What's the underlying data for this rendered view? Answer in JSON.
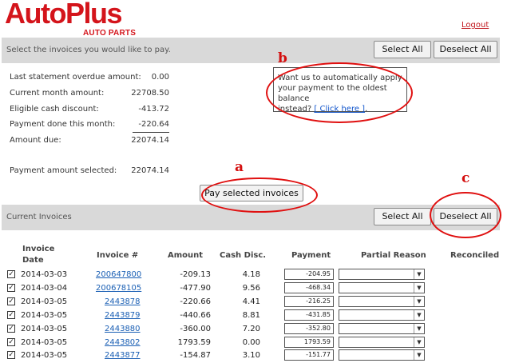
{
  "brand": {
    "name": "AutoPlus",
    "tagline": "AUTO PARTS"
  },
  "header": {
    "logout_label": "Logout"
  },
  "select_bar": {
    "instruction": "Select the invoices you would like to pay.",
    "select_all": "Select All",
    "deselect_all": "Deselect All"
  },
  "summary": [
    {
      "label": "Last statement overdue amount:",
      "value": "0.00"
    },
    {
      "label": "Current month amount:",
      "value": "22708.50"
    },
    {
      "label": "Eligible cash discount:",
      "value": "-413.72"
    },
    {
      "label": "Payment done this month:",
      "value": "-220.64"
    },
    {
      "label": "Amount due:",
      "value": "22074.14"
    }
  ],
  "payment_selected": {
    "label": "Payment amount selected:",
    "value": "22074.14"
  },
  "auto_apply": {
    "line1": "Want us to automatically apply",
    "line2": "your payment to the oldest balance",
    "line3_prefix": "instead? ",
    "link_label": "[ Click here ]",
    "line3_suffix": "."
  },
  "pay_button": "Pay selected invoices",
  "invoices_bar": {
    "title": "Current Invoices",
    "select_all": "Select All",
    "deselect_all": "Deselect All"
  },
  "annotations": {
    "a": "a",
    "b": "b",
    "c": "c"
  },
  "annotation_color": "#e01010",
  "brand_color": "#d4141b",
  "table": {
    "headers": {
      "invoice_date_1": "Invoice",
      "invoice_date_2": "Date",
      "invoice_num": "Invoice #",
      "amount": "Amount",
      "cash_disc": "Cash Disc.",
      "payment": "Payment",
      "partial_reason": "Partial Reason",
      "reconciled": "Reconciled"
    },
    "rows": [
      {
        "checked": "✓",
        "date": "2014-03-03",
        "invoice": "200647800",
        "amount": "-209.13",
        "cash_disc": "4.18",
        "payment": "-204.95"
      },
      {
        "checked": "✓",
        "date": "2014-03-04",
        "invoice": "200678105",
        "amount": "-477.90",
        "cash_disc": "9.56",
        "payment": "-468.34"
      },
      {
        "checked": "✓",
        "date": "2014-03-05",
        "invoice": "2443878",
        "amount": "-220.66",
        "cash_disc": "4.41",
        "payment": "-216.25"
      },
      {
        "checked": "✓",
        "date": "2014-03-05",
        "invoice": "2443879",
        "amount": "-440.66",
        "cash_disc": "8.81",
        "payment": "-431.85"
      },
      {
        "checked": "✓",
        "date": "2014-03-05",
        "invoice": "2443880",
        "amount": "-360.00",
        "cash_disc": "7.20",
        "payment": "-352.80"
      },
      {
        "checked": "✓",
        "date": "2014-03-05",
        "invoice": "2443802",
        "amount": "1793.59",
        "cash_disc": "0.00",
        "payment": "1793.59"
      },
      {
        "checked": "✓",
        "date": "2014-03-05",
        "invoice": "2443877",
        "amount": "-154.87",
        "cash_disc": "3.10",
        "payment": "-151.77"
      }
    ]
  }
}
